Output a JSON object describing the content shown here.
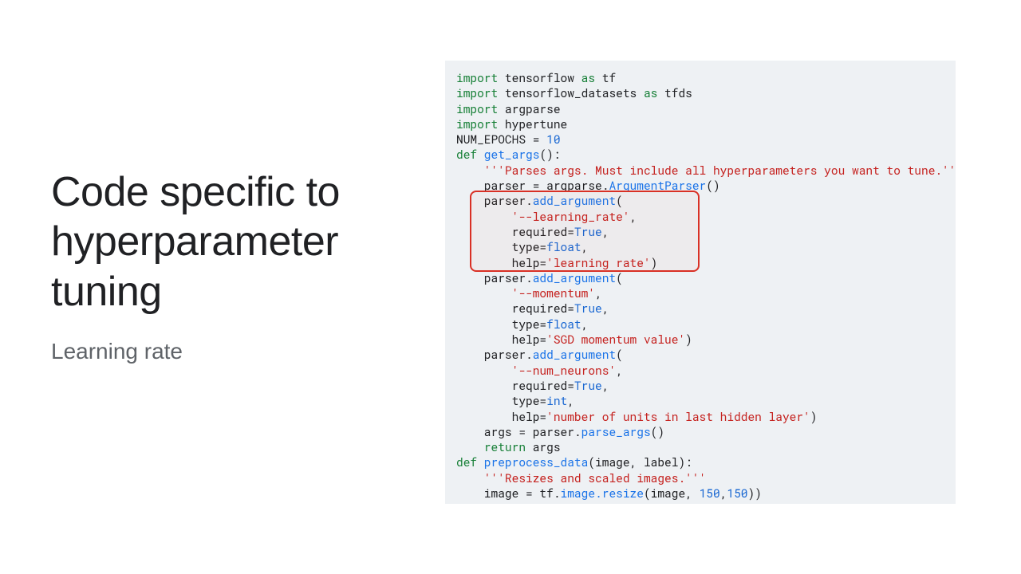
{
  "left": {
    "title_line1": "Code specific to",
    "title_line2": "hyperparameter",
    "title_line3": "tuning",
    "subtitle": "Learning rate"
  },
  "code": {
    "l01": {
      "a": "import",
      "b": " tensorflow ",
      "c": "as",
      "d": " tf"
    },
    "l02": {
      "a": "import",
      "b": " tensorflow_datasets ",
      "c": "as",
      "d": " tfds"
    },
    "l03": {
      "a": "import",
      "b": " argparse"
    },
    "l04": {
      "a": "import",
      "b": " hypertune"
    },
    "l05": {
      "a": "NUM_EPOCHS = ",
      "b": "10"
    },
    "l06": {
      "a": "def",
      "b": " get_args",
      "c": "():"
    },
    "l07": {
      "a": "    ",
      "b": "'''Parses args. Must include all hyperparameters you want to tune.'''"
    },
    "l08": {
      "a": "    parser = argparse.",
      "b": "ArgumentParser",
      "c": "()"
    },
    "l09": {
      "a": "    parser.",
      "b": "add_argument",
      "c": "("
    },
    "l10": {
      "a": "        ",
      "b": "'--learning_rate'",
      "c": ","
    },
    "l11": {
      "a": "        required=",
      "b": "True",
      "c": ","
    },
    "l12": {
      "a": "        type=",
      "b": "float",
      "c": ","
    },
    "l13": {
      "a": "        help=",
      "b": "'learning rate'",
      "c": ")"
    },
    "l14": {
      "a": "    parser.",
      "b": "add_argument",
      "c": "("
    },
    "l15": {
      "a": "        ",
      "b": "'--momentum'",
      "c": ","
    },
    "l16": {
      "a": "        required=",
      "b": "True",
      "c": ","
    },
    "l17": {
      "a": "        type=",
      "b": "float",
      "c": ","
    },
    "l18": {
      "a": "        help=",
      "b": "'SGD momentum value'",
      "c": ")"
    },
    "l19": {
      "a": "    parser.",
      "b": "add_argument",
      "c": "("
    },
    "l20": {
      "a": "        ",
      "b": "'--num_neurons'",
      "c": ","
    },
    "l21": {
      "a": "        required=",
      "b": "True",
      "c": ","
    },
    "l22": {
      "a": "        type=",
      "b": "int",
      "c": ","
    },
    "l23": {
      "a": "        help=",
      "b": "'number of units in last hidden layer'",
      "c": ")"
    },
    "l24": {
      "a": "    args = parser.",
      "b": "parse_args",
      "c": "()"
    },
    "l25": {
      "a": "    ",
      "b": "return",
      "c": " args"
    },
    "l26": {
      "a": "def",
      "b": " preprocess_data",
      "c": "(image, label):"
    },
    "l27": {
      "a": "    ",
      "b": "'''Resizes and scaled images.'''"
    },
    "l28": {
      "a": "    image = tf.",
      "b": "image.resize",
      "c": "(image, ",
      "d": "150",
      "e": ",",
      "f": "150",
      "g": "))"
    }
  }
}
